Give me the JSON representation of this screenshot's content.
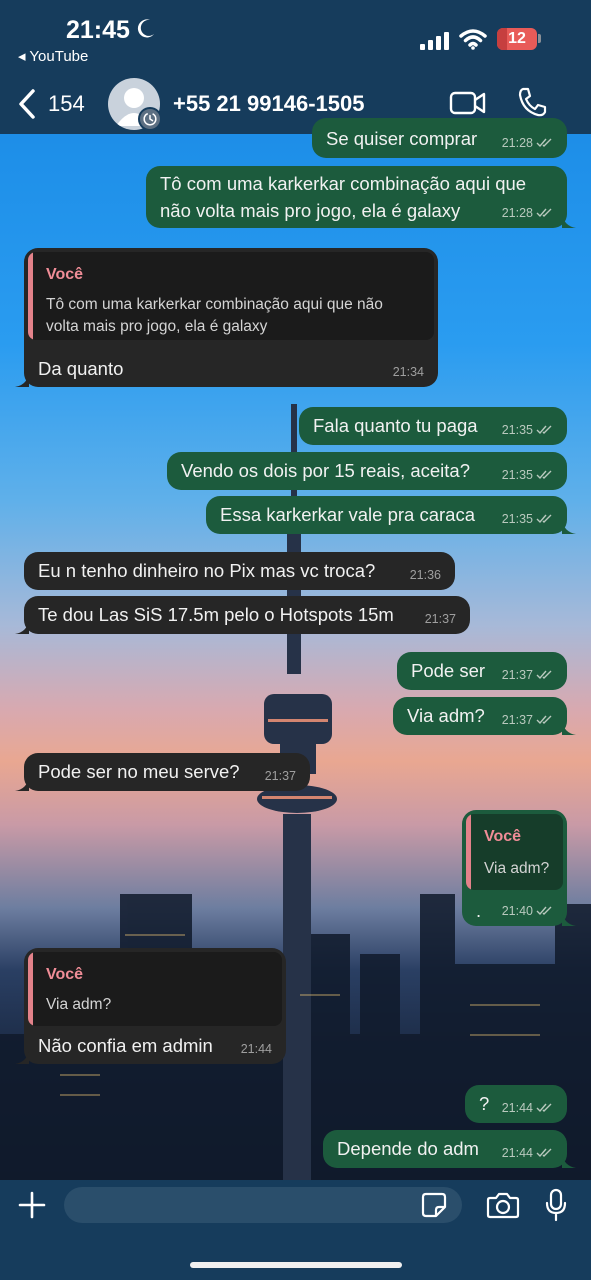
{
  "status_bar": {
    "time": "21:45",
    "back_app": "◂ YouTube",
    "battery": "12"
  },
  "chat_header": {
    "unread_count": "154",
    "contact": "+55 21 99146-1505"
  },
  "messages": [
    {
      "dir": "out",
      "text": "Se quiser comprar",
      "time": "21:28"
    },
    {
      "dir": "out",
      "text": "Tô com uma karkerkar combinação aqui que",
      "text2": "não volta mais pro jogo, ela é galaxy",
      "time": "21:28"
    },
    {
      "dir": "in",
      "quote_author": "Você",
      "quote_line1": "Tô com uma karkerkar combinação aqui que não",
      "quote_line2": "volta mais pro jogo, ela é galaxy",
      "text": "Da quanto",
      "time": "21:34"
    },
    {
      "dir": "out",
      "text": "Fala quanto tu paga",
      "time": "21:35"
    },
    {
      "dir": "out",
      "text": "Vendo os dois por 15 reais, aceita?",
      "time": "21:35"
    },
    {
      "dir": "out",
      "text": "Essa karkerkar vale pra caraca",
      "time": "21:35"
    },
    {
      "dir": "in",
      "text": "Eu n tenho dinheiro no Pix mas vc troca?",
      "time": "21:36"
    },
    {
      "dir": "in",
      "text": "Te dou Las SiS 17.5m pelo o Hotspots 15m",
      "time": "21:37"
    },
    {
      "dir": "out",
      "text": "Pode ser",
      "time": "21:37"
    },
    {
      "dir": "out",
      "text": "Via adm?",
      "time": "21:37"
    },
    {
      "dir": "in",
      "text": "Pode ser no meu serve?",
      "time": "21:37"
    },
    {
      "dir": "out",
      "quote_author": "Você",
      "quote_line1": "Via adm?",
      "text": ".",
      "time": "21:40"
    },
    {
      "dir": "in",
      "quote_author": "Você",
      "quote_line1": "Via adm?",
      "text": "Não confia em admin",
      "time": "21:44"
    },
    {
      "dir": "out",
      "text": "?",
      "time": "21:44"
    },
    {
      "dir": "out",
      "text": "Depende do adm",
      "time": "21:44"
    }
  ],
  "composer": {
    "placeholder": ""
  },
  "icons": {
    "back": "chevron-left-icon",
    "video": "video-camera-icon",
    "call": "phone-icon",
    "attach": "plus-icon",
    "sticker": "sticker-icon",
    "camera": "camera-icon",
    "mic": "microphone-icon"
  },
  "colors": {
    "header_bg": "#163c5c",
    "outgoing_bubble": "#1c5b3d",
    "incoming_bubble": "#262626",
    "quote_accent": "#f08d97"
  }
}
